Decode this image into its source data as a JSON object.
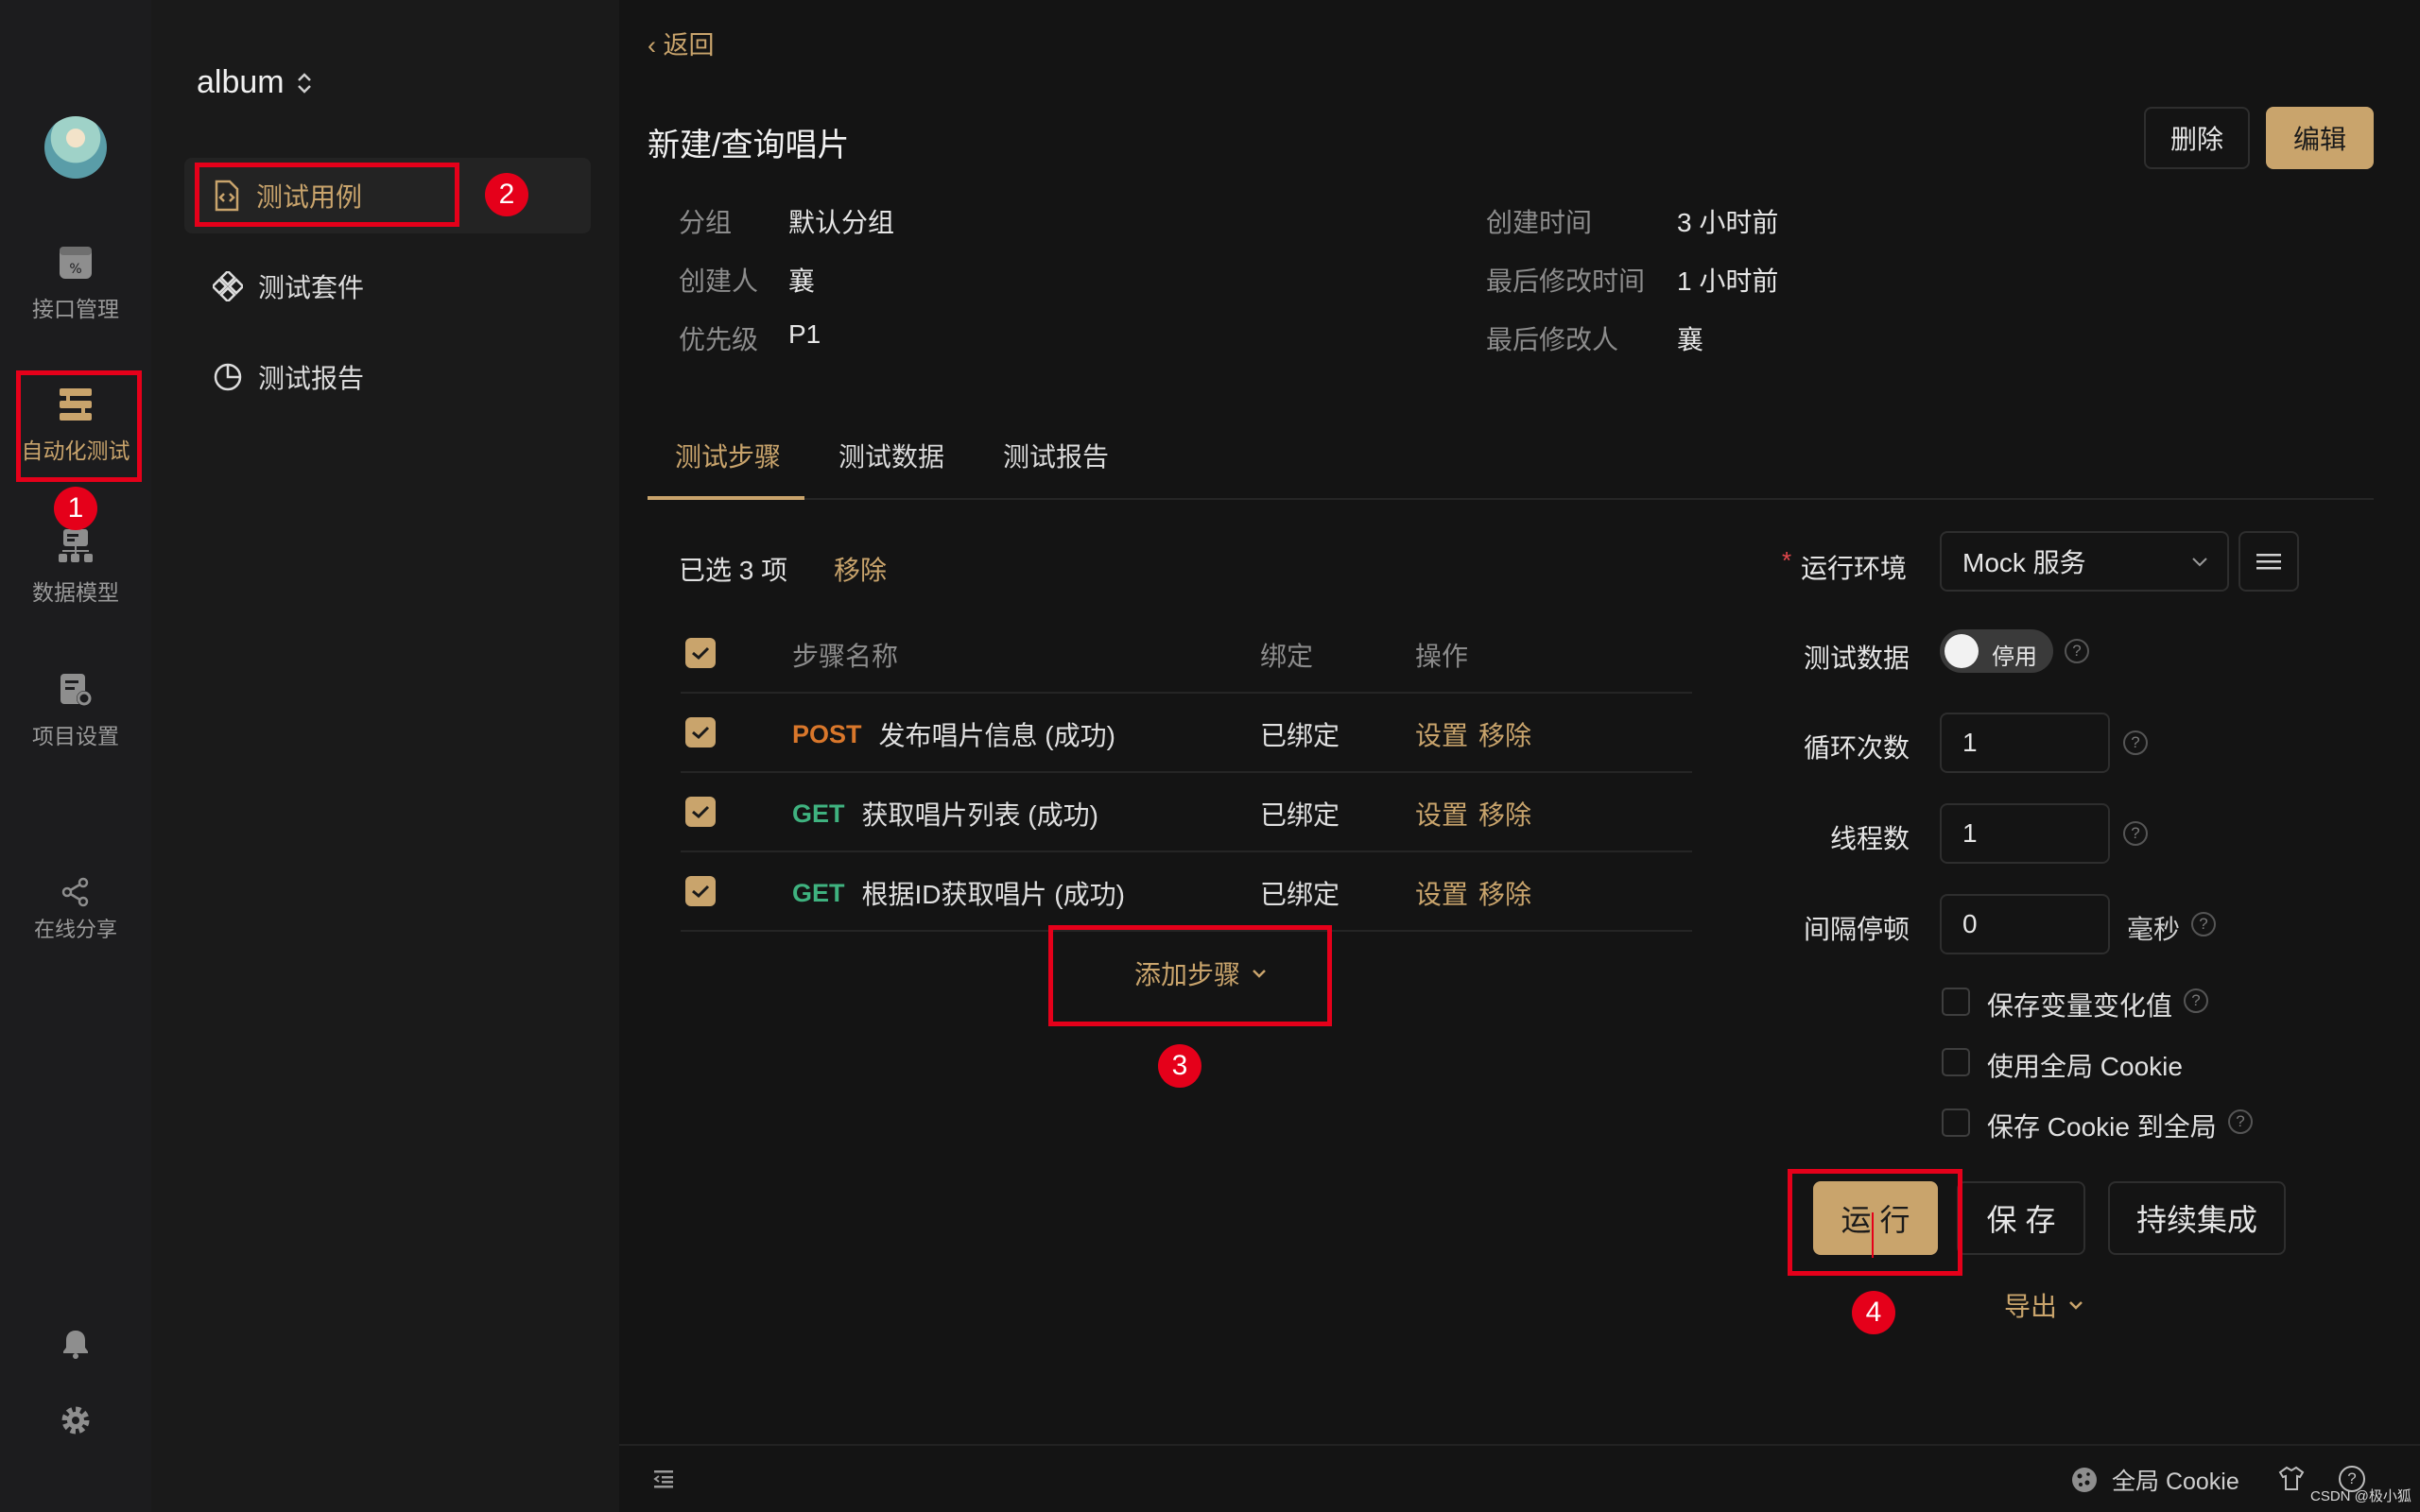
{
  "window": {
    "traffic_colors": [
      "#ff5f57",
      "#febc2e",
      "#28c840"
    ]
  },
  "rail": {
    "items": [
      {
        "label": "接口管理",
        "icon": "api-icon"
      },
      {
        "label": "自动化测试",
        "icon": "automation-icon"
      },
      {
        "label": "数据模型",
        "icon": "data-model-icon"
      },
      {
        "label": "项目设置",
        "icon": "project-settings-icon"
      },
      {
        "label": "在线分享",
        "icon": "share-icon"
      }
    ]
  },
  "project": {
    "name": "album"
  },
  "sidebar": {
    "items": [
      {
        "label": "测试用例",
        "icon": "test-case-icon"
      },
      {
        "label": "测试套件",
        "icon": "test-suite-icon"
      },
      {
        "label": "测试报告",
        "icon": "test-report-icon"
      }
    ]
  },
  "header": {
    "back_label": "返回",
    "title": "新建/查询唱片",
    "delete_label": "删除",
    "edit_label": "编辑"
  },
  "meta": {
    "group_key": "分组",
    "group_val": "默认分组",
    "creator_key": "创建人",
    "creator_val": "襄",
    "priority_key": "优先级",
    "priority_val": "P1",
    "created_key": "创建时间",
    "created_val": "3 小时前",
    "modified_key": "最后修改时间",
    "modified_val": "1 小时前",
    "modifier_key": "最后修改人",
    "modifier_val": "襄"
  },
  "tabs": [
    "测试步骤",
    "测试数据",
    "测试报告"
  ],
  "steps": {
    "selected_text": "已选 3 项",
    "remove_label": "移除",
    "col_name": "步骤名称",
    "col_bind": "绑定",
    "col_ops": "操作",
    "rows": [
      {
        "method": "POST",
        "name": "发布唱片信息 (成功)",
        "bind": "已绑定",
        "set": "设置",
        "remove": "移除"
      },
      {
        "method": "GET",
        "name": "获取唱片列表 (成功)",
        "bind": "已绑定",
        "set": "设置",
        "remove": "移除"
      },
      {
        "method": "GET",
        "name": "根据ID获取唱片 (成功)",
        "bind": "已绑定",
        "set": "设置",
        "remove": "移除"
      }
    ],
    "add_label": "添加步骤"
  },
  "run_panel": {
    "required_mark": "*",
    "env_label": "运行环境",
    "env_value": "Mock 服务",
    "test_data_label": "测试数据",
    "toggle_text": "停用",
    "loops_label": "循环次数",
    "loops_value": "1",
    "threads_label": "线程数",
    "threads_value": "1",
    "interval_label": "间隔停顿",
    "interval_value": "0",
    "interval_unit": "毫秒",
    "opt1": "保存变量变化值",
    "opt2": "使用全局 Cookie",
    "opt3": "保存 Cookie 到全局",
    "run_label": "运 行",
    "save_label": "保 存",
    "ci_label": "持续集成",
    "export_label": "导出"
  },
  "footer": {
    "cookie_label": "全局 Cookie",
    "watermark": "CSDN @极小狐"
  },
  "annotations": [
    "1",
    "2",
    "3",
    "4"
  ],
  "colors": {
    "accent": "#c9a46c",
    "post": "#d9772b",
    "get": "#3fb27f",
    "annotation": "#e5001a"
  }
}
